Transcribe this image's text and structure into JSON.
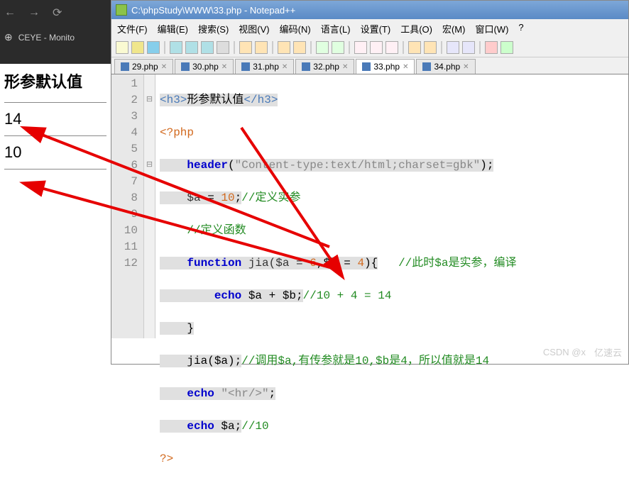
{
  "browser": {
    "tab_title": "CEYE - Monito",
    "content_heading": "形参默认值",
    "result1": "14",
    "result2": "10"
  },
  "npp": {
    "title": "C:\\phpStudy\\WWW\\33.php - Notepad++",
    "menu": [
      "文件(F)",
      "编辑(E)",
      "搜索(S)",
      "视图(V)",
      "编码(N)",
      "语言(L)",
      "设置(T)",
      "工具(O)",
      "宏(M)",
      "窗口(W)",
      "?"
    ],
    "tabs": [
      "29.php",
      "30.php",
      "31.php",
      "32.php",
      "33.php",
      "34.php"
    ],
    "active_tab": 4,
    "lines": [
      "1",
      "2",
      "3",
      "4",
      "5",
      "6",
      "7",
      "8",
      "9",
      "10",
      "11",
      "12"
    ],
    "code": {
      "l1_tag_open": "<h3>",
      "l1_text": "形参默认值",
      "l1_tag_close": "</h3>",
      "l2": "<?php",
      "l3_fn": "header",
      "l3_str": "\"Content-type:text/html;charset=gbk\"",
      "l4_var": "$a",
      "l4_eq": " = ",
      "l4_num": "10",
      "l4_cmt": "//定义实参",
      "l5_cmt": "//定义函数",
      "l6_kw": "function",
      "l6_sig": " jia($a = ",
      "l6_n1": "6",
      "l6_mid": ",$b = ",
      "l6_n2": "4",
      "l6_end": "){",
      "l6_cmt": "//此时$a是实参，编译",
      "l7_kw": "echo",
      "l7_expr": " $a + $b;",
      "l7_cmt": "//10 + 4 = 14",
      "l8": "}",
      "l9_call": "jia($a);",
      "l9_cmt": "//调用$a,有传参就是10,$b是4，所以值就是14",
      "l10_kw": "echo",
      "l10_str": " \"<hr/>\"",
      "l11_kw": "echo",
      "l11_expr": " $a;",
      "l11_cmt": "//10",
      "l12": "?>"
    }
  },
  "watermark": {
    "csdn": "CSDN @x",
    "yisu": "亿速云"
  }
}
